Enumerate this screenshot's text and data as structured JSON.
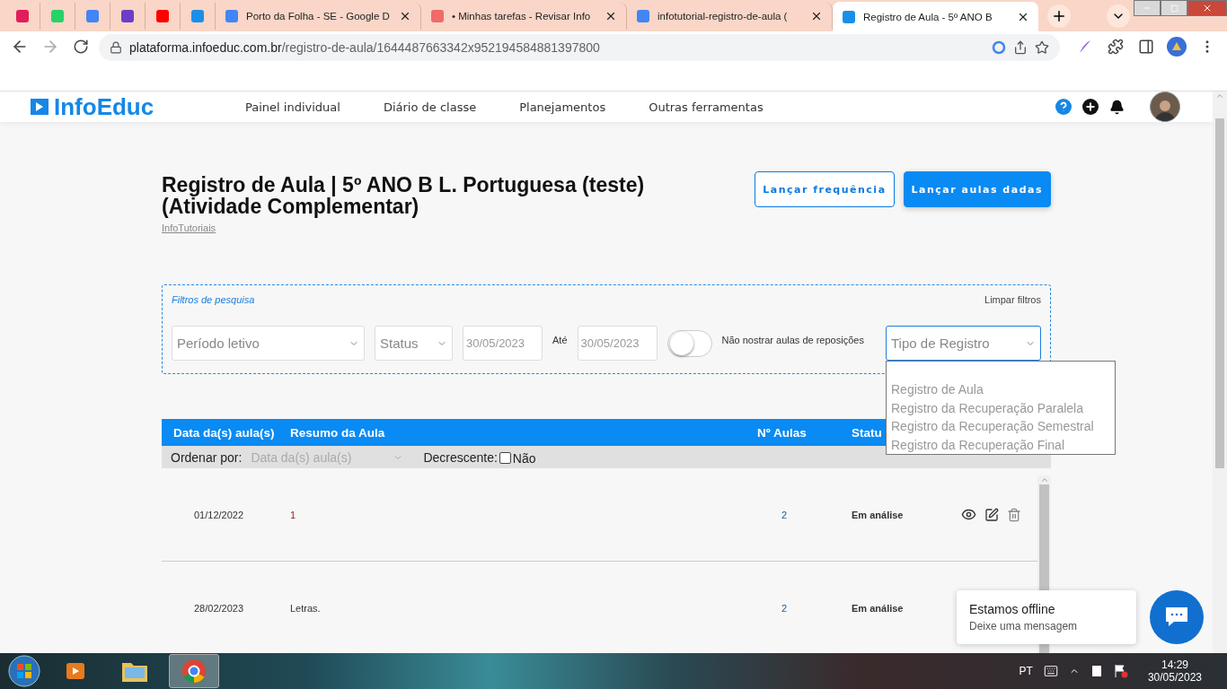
{
  "browser": {
    "tabs": [
      {
        "title": "Porto da Folha - SE - Google D",
        "selected": false
      },
      {
        "title": "• Minhas tarefas - Revisar Info",
        "selected": false
      },
      {
        "title": "infotutorial-registro-de-aula (",
        "selected": false
      },
      {
        "title": "Registro de Aula - 5º ANO B",
        "selected": true
      }
    ],
    "url": {
      "host": "plataforma.infoeduc.com.br",
      "path": "/registro-de-aula/1644487663342x952194584881397800"
    }
  },
  "header": {
    "logo": "InfoEduc",
    "nav": [
      "Painel individual",
      "Diário de classe",
      "Planejamentos",
      "Outras ferramentas"
    ]
  },
  "page": {
    "title": "Registro de Aula | 5º ANO B L. Portuguesa (teste) (Atividade Complementar)",
    "subtitle": "InfoTutoriais",
    "buttons": [
      {
        "label": "Lançar frequência",
        "kind": "outline"
      },
      {
        "label": "Lançar aulas dadas",
        "kind": "primary"
      }
    ]
  },
  "filters": {
    "legend": "Filtros de pesquisa",
    "clear": "Limpar filtros",
    "period": "Período letivo",
    "status": "Status",
    "date_from": "30/05/2023",
    "until": "Até",
    "date_to": "30/05/2023",
    "toggle": {
      "label": "Não nostrar aulas de reposições",
      "on": false
    },
    "type": {
      "placeholder": "Tipo de Registro",
      "expanded": true,
      "options": [
        "Registro de Aula",
        "Registro da Recuperação Paralela",
        "Registro da Recuperação Semestral",
        "Registro da Recuperação Final"
      ]
    }
  },
  "table": {
    "columns": [
      "Data da(s) aula(s)",
      "Resumo da Aula",
      "Nº Aulas",
      "Statu"
    ],
    "sort": {
      "label": "Ordenar por:",
      "field": "Data da(s) aula(s)",
      "desc_label": "Decrescente:",
      "desc_checked": false,
      "desc_value": "Não"
    },
    "rows": [
      {
        "date": "01/12/2022",
        "summary": "1",
        "count": "2",
        "status": "Em análise"
      },
      {
        "date": "28/02/2023",
        "summary": "Letras.",
        "count": "2",
        "status": "Em análise"
      }
    ]
  },
  "chat": {
    "title": "Estamos offline",
    "subtitle": "Deixe uma mensagem"
  },
  "taskbar": {
    "apps": [
      {
        "kind": "media",
        "selected": false
      },
      {
        "kind": "explorer",
        "selected": false
      },
      {
        "kind": "chrome",
        "selected": true
      }
    ],
    "language": "PT",
    "time": "14:29",
    "date": "30/05/2023"
  }
}
